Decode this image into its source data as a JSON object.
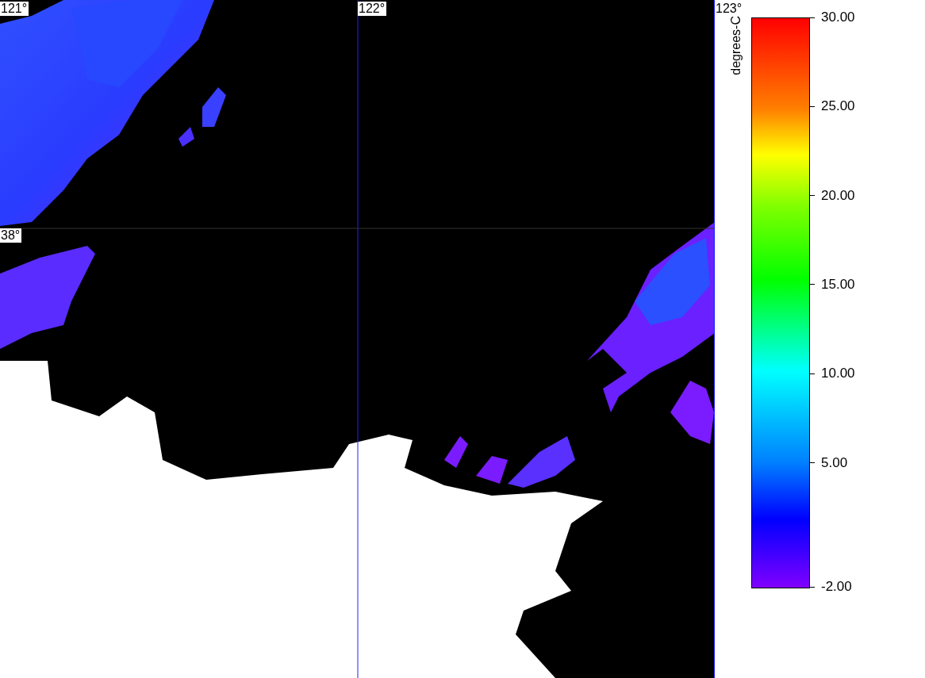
{
  "map": {
    "lon_labels": [
      "121°",
      "122°",
      "123°"
    ],
    "lat_labels": [
      "38°"
    ]
  },
  "colorbar": {
    "unit": "degrees-C",
    "ticks": [
      "30.00",
      "25.00",
      "20.00",
      "15.00",
      "10.00",
      "5.00",
      "-2.00"
    ]
  }
}
